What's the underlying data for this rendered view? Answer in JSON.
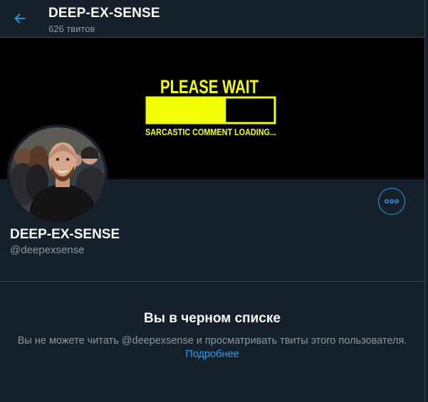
{
  "colors": {
    "background": "#15202b",
    "border": "#38444d",
    "accent": "#1da1f2",
    "secondary_text": "#8899a6",
    "banner_yellow": "#f2ff00"
  },
  "header": {
    "back_icon": "arrow-left-icon",
    "title": "DEEP-EX-SENSE",
    "tweet_count": "626 твитов"
  },
  "banner": {
    "headline": "PLEASE WAIT",
    "caption": "SARCASTIC COMMENT LOADING...",
    "progress_fraction": 0.62
  },
  "profile": {
    "display_name": "DEEP-EX-SENSE",
    "handle": "@deepexsense",
    "more_icon": "more-horizontal-icon"
  },
  "blocked": {
    "title": "Вы в черном списке",
    "message": "Вы не можете читать @deepexsense и просматривать твиты этого пользователя.",
    "learn_more": "Подробнее"
  }
}
